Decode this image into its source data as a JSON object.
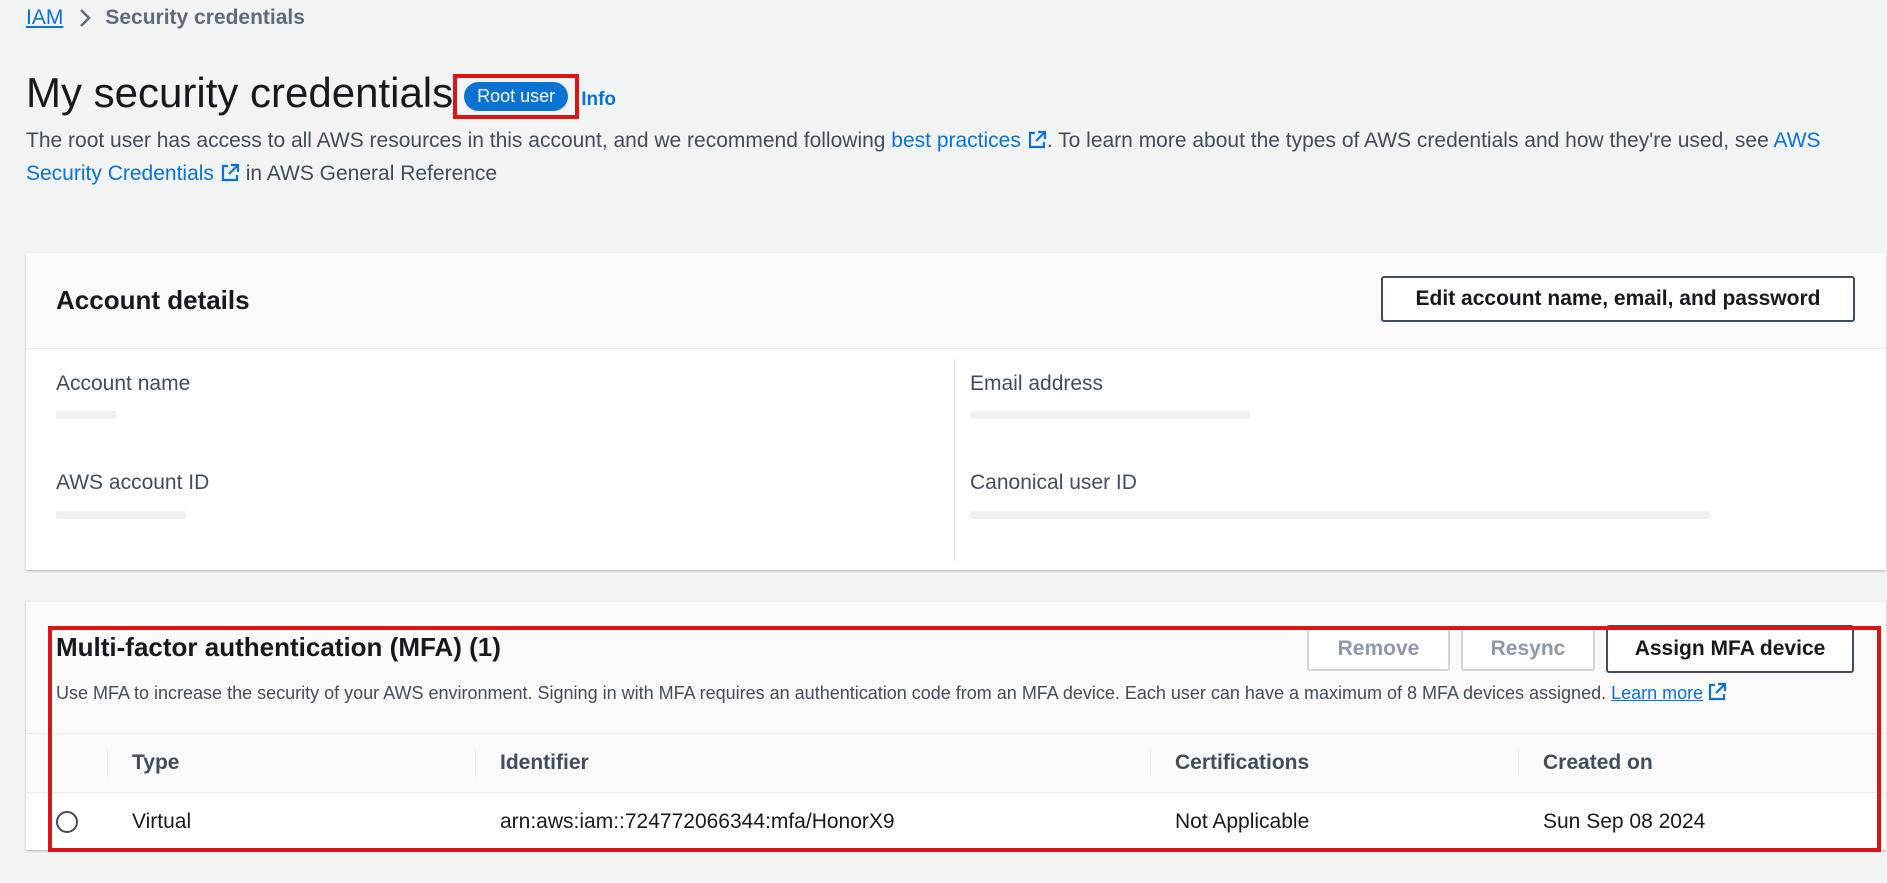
{
  "breadcrumb": {
    "root": "IAM",
    "current": "Security credentials"
  },
  "header": {
    "title": "My security credentials",
    "badge": "Root user",
    "info": "Info",
    "intro_part1": "The root user has access to all AWS resources in this account, and we recommend following ",
    "best_practices_link": "best practices",
    "intro_part2": ". To learn more about the types of AWS credentials and how they're used, see ",
    "aws_security_link": "AWS Security Credentials",
    "intro_part3": " in AWS General Reference"
  },
  "account_details": {
    "title": "Account details",
    "edit_button": "Edit account name, email, and password",
    "fields": {
      "account_name_label": "Account name",
      "email_label": "Email address",
      "account_id_label": "AWS account ID",
      "canonical_id_label": "Canonical user ID"
    }
  },
  "mfa": {
    "title": "Multi-factor authentication (MFA) (1)",
    "remove_button": "Remove",
    "resync_button": "Resync",
    "assign_button": "Assign MFA device",
    "description": "Use MFA to increase the security of your AWS environment. Signing in with MFA requires an authentication code from an MFA device. Each user can have a maximum of 8 MFA devices assigned.",
    "learn_more": "Learn more",
    "columns": [
      "Type",
      "Identifier",
      "Certifications",
      "Created on"
    ],
    "rows": [
      {
        "type": "Virtual",
        "identifier": "arn:aws:iam::724772066344:mfa/HonorX9",
        "certifications": "Not Applicable",
        "created_on": "Sun Sep 08 2024"
      }
    ]
  },
  "colors": {
    "link": "#0972d3",
    "highlight": "#d91515",
    "badge": "#0972d3"
  },
  "icons": [
    "chevron-right-icon",
    "external-link-icon",
    "radio-icon"
  ]
}
